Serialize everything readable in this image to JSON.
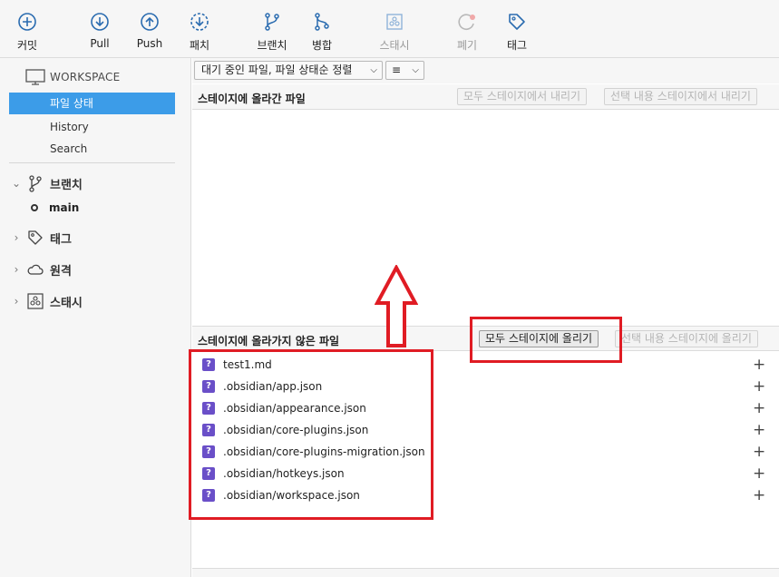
{
  "toolbar": {
    "commit": {
      "label": "커밋",
      "icon": "plus-circle-icon"
    },
    "pull": {
      "label": "Pull",
      "icon": "arrow-down-circle-icon"
    },
    "push": {
      "label": "Push",
      "icon": "arrow-up-circle-icon"
    },
    "fetch": {
      "label": "패치",
      "icon": "fetch-circle-icon"
    },
    "branch": {
      "label": "브랜치",
      "icon": "branch-icon"
    },
    "merge": {
      "label": "병합",
      "icon": "merge-icon"
    },
    "stash": {
      "label": "스태시",
      "icon": "stash-icon"
    },
    "discard": {
      "label": "폐기",
      "icon": "discard-icon"
    },
    "tag": {
      "label": "태그",
      "icon": "tag-icon"
    }
  },
  "sidebar": {
    "workspace_label": "WORKSPACE",
    "workspace_items": [
      {
        "label": "파일 상태",
        "active": true
      },
      {
        "label": "History",
        "active": false
      },
      {
        "label": "Search",
        "active": false
      }
    ],
    "branches_label": "브랜치",
    "current_branch": "main",
    "tags_label": "태그",
    "remotes_label": "원격",
    "stashes_label": "스태시"
  },
  "main": {
    "filter_select": "대기 중인 파일, 파일 상태순 정렬",
    "view_select_icon": "list-view-icon",
    "staged": {
      "title": "스테이지에 올라간 파일",
      "unstage_all": "모두 스테이지에서 내리기",
      "unstage_selected": "선택 내용 스테이지에서 내리기"
    },
    "unstaged": {
      "title": "스테이지에 올라가지 않은 파일",
      "stage_all": "모두 스테이지에 올리기",
      "stage_selected": "선택 내용 스테이지에 올리기",
      "files": [
        "test1.md",
        ".obsidian/app.json",
        ".obsidian/appearance.json",
        ".obsidian/core-plugins.json",
        ".obsidian/core-plugins-migration.json",
        ".obsidian/hotkeys.json",
        ".obsidian/workspace.json"
      ]
    }
  },
  "colors": {
    "accent": "#3c9ce8",
    "annotation_red": "#e01c24",
    "untracked_icon": "#6a4fc8",
    "toolbar_icon": "#2b6cb0"
  }
}
